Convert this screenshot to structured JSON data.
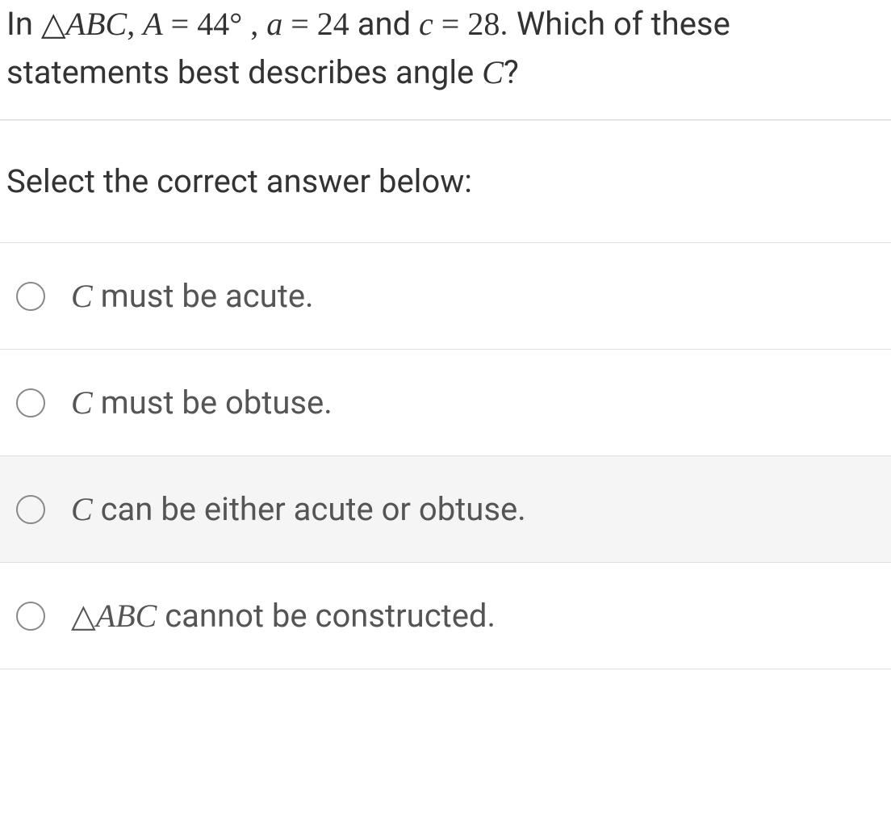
{
  "question": {
    "prefix": "In ",
    "triangle": "△",
    "triangle_name": "ABC",
    "sep1": ", ",
    "varA": "A",
    "eq1": " = ",
    "valA": "44°",
    "sep2": " , ",
    "vara": "a",
    "eq2": " = ",
    "vala": "24",
    "and": " and ",
    "varc": "c",
    "eq3": " = ",
    "valc": "28",
    "after": ". Which of these statements best describes angle ",
    "varC": "C",
    "qmark": "?"
  },
  "prompt": "Select the correct answer below:",
  "answers": [
    {
      "var": "C",
      "text": " must be acute."
    },
    {
      "var": "C",
      "text": " must be obtuse."
    },
    {
      "var": "C",
      "text": " can be either acute or obtuse."
    },
    {
      "triangle": "△",
      "triangle_name": "ABC",
      "text": " cannot be constructed."
    }
  ]
}
